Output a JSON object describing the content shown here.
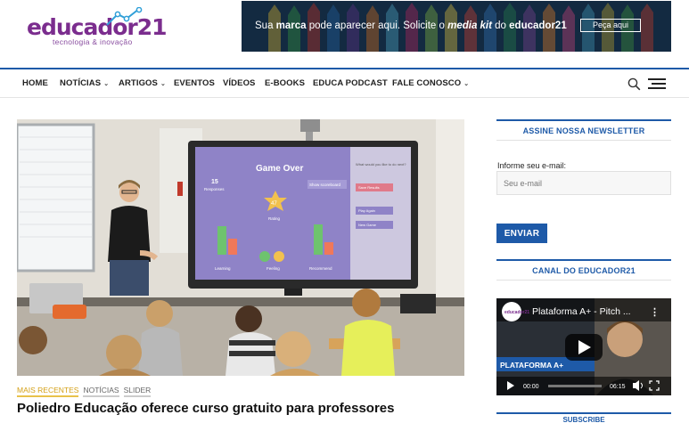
{
  "brand": {
    "logo_name": "educador21",
    "logo_prefix": "educador",
    "logo_suffix": "21",
    "tagline": "tecnologia & inovação",
    "accent": "#7b2d8e",
    "blue": "#1e5aa8"
  },
  "banner": {
    "pre": "Sua ",
    "bold1": "marca",
    "mid": " pode aparecer aqui. Solicite o ",
    "italic": "media kit",
    "post": " do ",
    "brand": "educador21",
    "button": "Peça aqui"
  },
  "nav": {
    "items": [
      {
        "label": "HOME",
        "dropdown": false
      },
      {
        "label": "NOTÍCIAS",
        "dropdown": true
      },
      {
        "label": "ARTIGOS",
        "dropdown": true
      },
      {
        "label": "EVENTOS",
        "dropdown": false
      },
      {
        "label": "VÍDEOS",
        "dropdown": false
      },
      {
        "label": "E-BOOKS",
        "dropdown": false
      },
      {
        "label": "EDUCA PODCAST",
        "dropdown": false
      },
      {
        "label": "FALE CONOSCO",
        "dropdown": true
      }
    ],
    "chevron": "⌄",
    "search_icon": "search-icon",
    "menu_icon": "hamburger-icon"
  },
  "featured": {
    "image_icon": "classroom-photo",
    "board_title": "Game Over",
    "board_score": "15",
    "board_score_label": "Responses",
    "board_btn": "Show scoreboard",
    "board_center": "47",
    "board_center_label": "Rating",
    "board_labels": [
      "Learning",
      "Feeling",
      "Recommend"
    ],
    "board_side_q": "What would you like to do next?",
    "board_side_btns": [
      "Save Results",
      "Play Again",
      "New Game"
    ],
    "tags": [
      "MAIS RECENTES",
      "NOTÍCIAS",
      "SLIDER"
    ],
    "headline": "Poliedro Educação oferece curso gratuito para professores"
  },
  "sidebar": {
    "newsletter_title": "ASSINE NOSSA NEWSLETTER",
    "email_label": "Informe seu e-mail:",
    "email_placeholder": "Seu e-mail",
    "email_value": "",
    "submit": "ENVIAR",
    "channel_title": "CANAL DO EDUCADOR21",
    "video": {
      "title": "Plataforma A+ - Pitch ...",
      "channel_badge": "educador21",
      "overlay": "PLATAFORMA A+",
      "time_current": "00:00",
      "time_total": "06:15",
      "progress": 0
    },
    "subscribe_title": "SUBSCRIBE"
  }
}
